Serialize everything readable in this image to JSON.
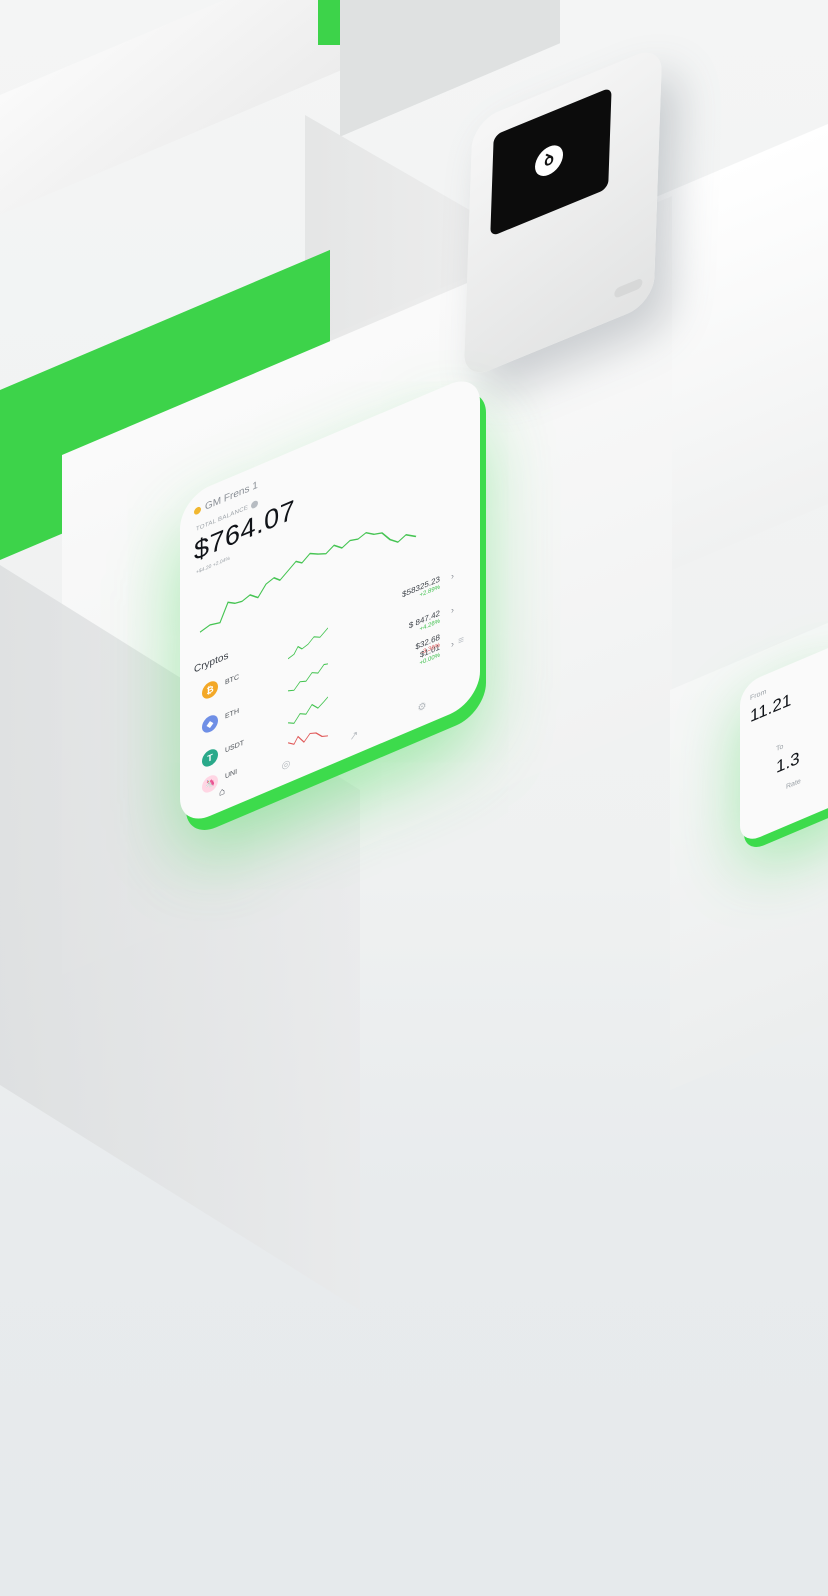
{
  "wallet": {
    "logo": "ꝺ"
  },
  "phone": {
    "account_name": "GM Frens 1",
    "total_balance_label": "TOTAL BALANCE",
    "balance": "$764.07",
    "balance_change": "+$4.20 +2.04%",
    "cryptos_title": "Cryptos",
    "coins": [
      {
        "name": "BTC",
        "symbol": "₿",
        "color": "#f3a827",
        "price": "$58325.23",
        "change": "+2.89%",
        "change_color": "#3bbf4a",
        "trend": "up"
      },
      {
        "name": "ETH",
        "symbol": "◆",
        "color": "#6f8fe6",
        "price": "$ 847.42",
        "change": "+4.26%",
        "change_color": "#3bbf4a",
        "trend": "up"
      },
      {
        "name": "USDT",
        "symbol": "T",
        "color": "#2aa98a",
        "price": "$1.01",
        "change": "+0.00%",
        "change_color": "#3bbf4a",
        "trend": "up"
      },
      {
        "name": "UNI",
        "symbol": "🦄",
        "color": "#ffd6e4",
        "price": "$32.68",
        "change": "-3.36%",
        "change_color": "#e05757",
        "trend": "down"
      }
    ],
    "nav": [
      "home-icon",
      "coin-icon",
      "chart-icon",
      "settings-icon"
    ],
    "accent": "#3ddb4c"
  },
  "exchange": {
    "from_label": "From",
    "from_value": "11.21",
    "to_label": "To",
    "to_value": "1.3",
    "rate_label": "Rate"
  }
}
